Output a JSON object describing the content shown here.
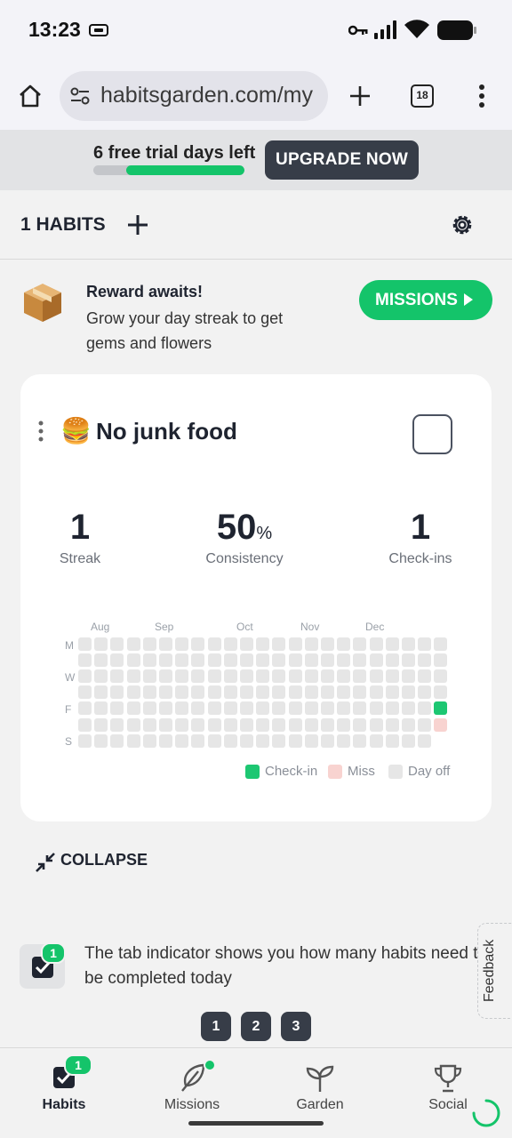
{
  "status_bar": {
    "time": "13:23"
  },
  "browser": {
    "url": "habitsgarden.com/my",
    "tab_count": "18"
  },
  "trial": {
    "text": "6 free trial days left",
    "progress": 0.78,
    "upgrade_label": "UPGRADE NOW"
  },
  "habits_header": {
    "count_label": "1 HABITS"
  },
  "reward": {
    "title": "Reward awaits!",
    "description": "Grow your day streak to get gems and flowers",
    "missions_label": "MISSIONS"
  },
  "habit": {
    "emoji": "🍔",
    "name": "No junk food",
    "stats": [
      {
        "value": "1",
        "unit": "",
        "label": "Streak"
      },
      {
        "value": "50",
        "unit": "%",
        "label": "Consistency"
      },
      {
        "value": "1",
        "unit": "",
        "label": "Check-ins"
      }
    ],
    "calendar": {
      "months": [
        "Aug",
        "Sep",
        "Oct",
        "Nov",
        "Dec"
      ],
      "day_labels": [
        "M",
        "W",
        "F",
        "S"
      ],
      "weeks": 23,
      "last_week_days": 6,
      "check_in": {
        "week": 22,
        "day": 4
      },
      "miss": {
        "week": 22,
        "day": 5
      }
    },
    "legend": [
      {
        "label": "Check-in",
        "color": "#1dc772"
      },
      {
        "label": "Miss",
        "color": "#f8d3d0"
      },
      {
        "label": "Day off",
        "color": "#e6e6e6"
      }
    ],
    "colors": {
      "checkin": "#1dc772",
      "miss": "#f8d3d0",
      "off": "#e6e6e6"
    }
  },
  "collapse_label": "COLLAPSE",
  "tip": {
    "badge": "1",
    "text": "The tab indicator shows you how many habits need to be completed today"
  },
  "feedback_label": "Feedback",
  "pagination": [
    "1",
    "2",
    "3"
  ],
  "bottom_nav": [
    {
      "label": "Habits",
      "icon": "check-square-icon",
      "badge": "1",
      "active": true
    },
    {
      "label": "Missions",
      "icon": "feather-icon",
      "dot": true
    },
    {
      "label": "Garden",
      "icon": "sprout-icon"
    },
    {
      "label": "Social",
      "icon": "trophy-icon"
    }
  ]
}
